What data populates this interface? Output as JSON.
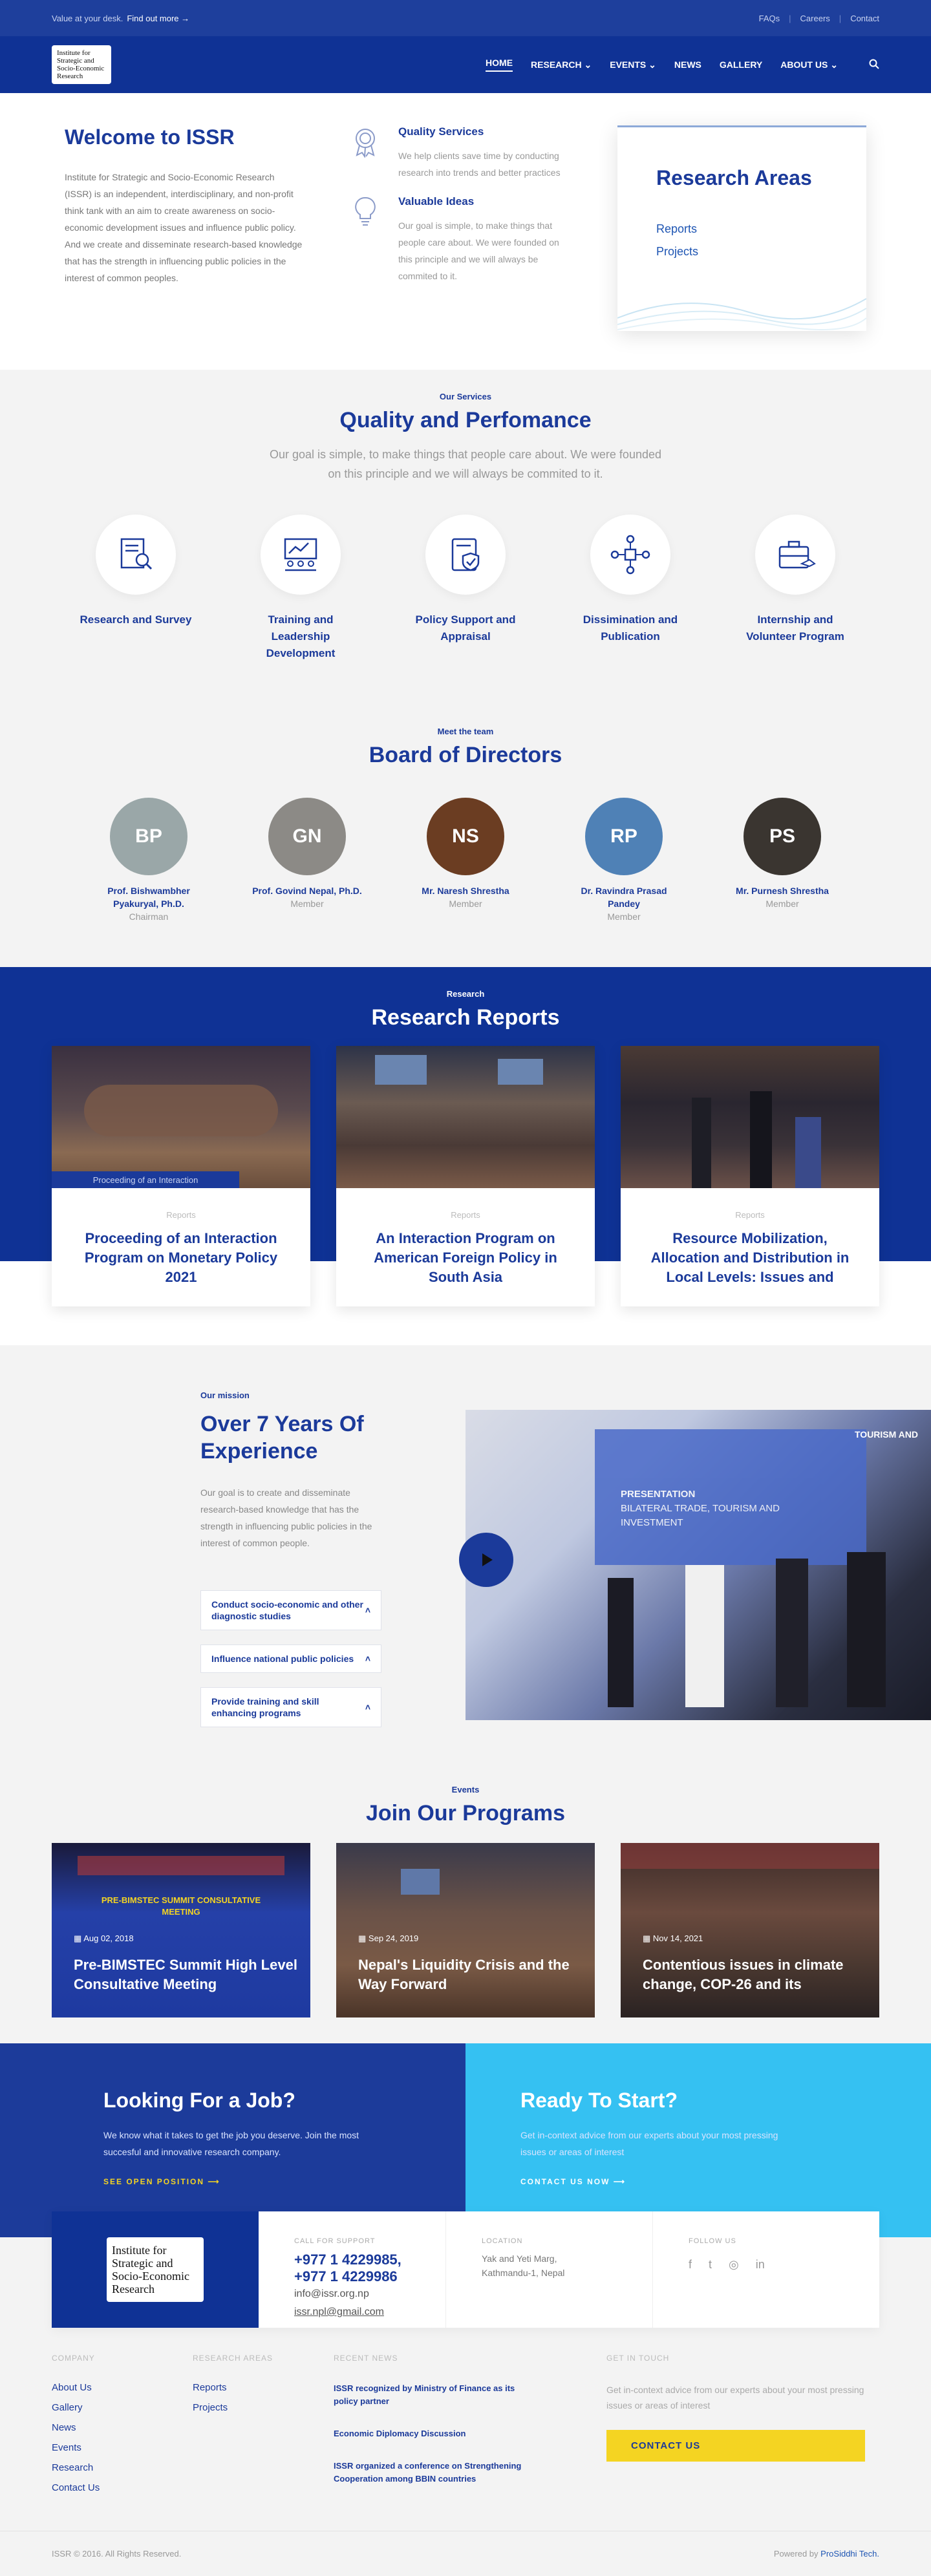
{
  "topbar": {
    "tagline": "Value at your desk.",
    "find_out": "Find out more →",
    "links": [
      "FAQs",
      "Careers",
      "Contact"
    ]
  },
  "logo": {
    "lines": [
      "Institute for",
      "Strategic and",
      "Socio-Economic",
      "Research"
    ]
  },
  "nav": {
    "items": [
      "HOME",
      "RESEARCH",
      "EVENTS",
      "NEWS",
      "GALLERY",
      "ABOUT US"
    ]
  },
  "welcome": {
    "title": "Welcome to ISSR",
    "text": "Institute for Strategic and Socio-Economic Research (ISSR) is an independent, interdisciplinary, and non-profit think tank with an aim to create awareness on socio-economic development issues and influence public policy. And we create and disseminate research-based knowledge that has the strength in influencing public policies in the interest of common peoples.",
    "features": [
      {
        "title": "Quality Services",
        "text": "We help clients save time by conducting research into trends and better practices",
        "icon": "award-icon"
      },
      {
        "title": "Valuable Ideas",
        "text": "Our goal is simple, to make things that people care about. We were founded on this principle and we will always be commited to it.",
        "icon": "lightbulb-icon"
      }
    ],
    "research_areas": {
      "title": "Research Areas",
      "links": [
        "Reports",
        "Projects"
      ]
    }
  },
  "services": {
    "eyebrow": "Our Services",
    "title": "Quality and Perfomance",
    "subtitle_1": "Our goal is simple, to make things that people care about. We were founded",
    "subtitle_2": "on this principle and we will always be commited to it.",
    "items": [
      {
        "label": "Research and Survey",
        "icon": "research-icon"
      },
      {
        "label": "Training and Leadership Development",
        "icon": "training-icon"
      },
      {
        "label": "Policy Support and Appraisal",
        "icon": "policy-icon"
      },
      {
        "label": "Dissimination and Publication",
        "icon": "network-icon"
      },
      {
        "label": "Internship and Volunteer Program",
        "icon": "briefcase-icon"
      }
    ]
  },
  "team": {
    "eyebrow": "Meet the team",
    "title": "Board of Directors",
    "members": [
      {
        "name": "Prof. Bishwambher Pyakuryal, Ph.D.",
        "role": "Chairman",
        "initials": "BP",
        "color": "#9aa7a8"
      },
      {
        "name": "Prof. Govind Nepal, Ph.D.",
        "role": "Member",
        "initials": "GN",
        "color": "#8c8a86"
      },
      {
        "name": "Mr. Naresh Shrestha",
        "role": "Member",
        "initials": "NS",
        "color": "#6b3d22"
      },
      {
        "name": "Dr. Ravindra Prasad Pandey",
        "role": "Member",
        "initials": "RP",
        "color": "#4f81b6"
      },
      {
        "name": "Mr. Purnesh Shrestha",
        "role": "Member",
        "initials": "PS",
        "color": "#3a3530"
      }
    ]
  },
  "reports": {
    "eyebrow": "Research",
    "title": "Research Reports",
    "items": [
      {
        "category": "Reports",
        "title": "Proceeding of an Interaction Program on Monetary Policy 2021",
        "overlay": "Proceeding of an Interaction"
      },
      {
        "category": "Reports",
        "title": "An Interaction Program on American Foreign Policy in South Asia"
      },
      {
        "category": "Reports",
        "title": "Resource Mobilization, Allocation and Distribution in Local Levels: Issues and"
      }
    ]
  },
  "mission": {
    "eyebrow": "Our mission",
    "title": "Over 7 Years Of Experience",
    "text": "Our goal is to create and disseminate research-based knowledge that has the strength in influencing public policies in the interest of common people.",
    "accordion": [
      "Conduct socio-economic and other diagnostic studies",
      "Influence national public policies",
      "Provide training and skill enhancing programs"
    ],
    "photo_text_1": "PRESENTATION",
    "photo_text_2": "BILATERAL TRADE, TOURISM AND INVESTMENT",
    "photo_text_3": "TOURISM AND"
  },
  "programs": {
    "eyebrow": "Events",
    "title": "Join Our Programs",
    "items": [
      {
        "date": "Aug 02, 2018",
        "title": "Pre-BIMSTEC Summit High Level Consultative Meeting",
        "banner": "PRE-BIMSTEC SUMMIT CONSULTATIVE MEETING"
      },
      {
        "date": "Sep 24, 2019",
        "title": "Nepal's Liquidity Crisis and the Way Forward"
      },
      {
        "date": "Nov 14, 2021",
        "title": "Contentious issues in climate change, COP-26 and its"
      }
    ]
  },
  "cta": {
    "job": {
      "title": "Looking For a Job?",
      "text": "We know what it takes to get the job you deserve. Join the most succesful and innovative research company.",
      "link": "SEE OPEN POSITION"
    },
    "start": {
      "title": "Ready To Start?",
      "text": "Get in-context advice from our experts about your most pressing issues or areas of interest",
      "link": "CONTACT US NOW"
    }
  },
  "contact": {
    "support_label": "CALL FOR SUPPORT",
    "phone_1": "+977 1 4229985,",
    "phone_2": "+977 1 4229986",
    "email_1": "info@issr.org.np",
    "email_2": "issr.npl@gmail.com",
    "location_label": "LOCATION",
    "location": "Yak and Yeti Marg, Kathmandu-1, Nepal",
    "follow_label": "FOLLOW US"
  },
  "footer": {
    "company": {
      "heading": "COMPANY",
      "links": [
        "About Us",
        "Gallery",
        "News",
        "Events",
        "Research",
        "Contact Us"
      ]
    },
    "research": {
      "heading": "RESEARCH AREAS",
      "links": [
        "Reports",
        "Projects"
      ]
    },
    "news": {
      "heading": "RECENT NEWS",
      "items": [
        "ISSR recognized by Ministry of Finance as its policy partner",
        "Economic Diplomacy Discussion",
        "ISSR organized a conference on Strengthening Cooperation among BBIN countries"
      ]
    },
    "touch": {
      "heading": "GET IN TOUCH",
      "text": "Get in-context advice from our experts about your most pressing issues or areas of interest",
      "button": "CONTACT US"
    },
    "copyright": "ISSR © 2016. All Rights Reserved.",
    "powered": "Powered by",
    "powered_brand": "ProSiddhi Tech."
  }
}
